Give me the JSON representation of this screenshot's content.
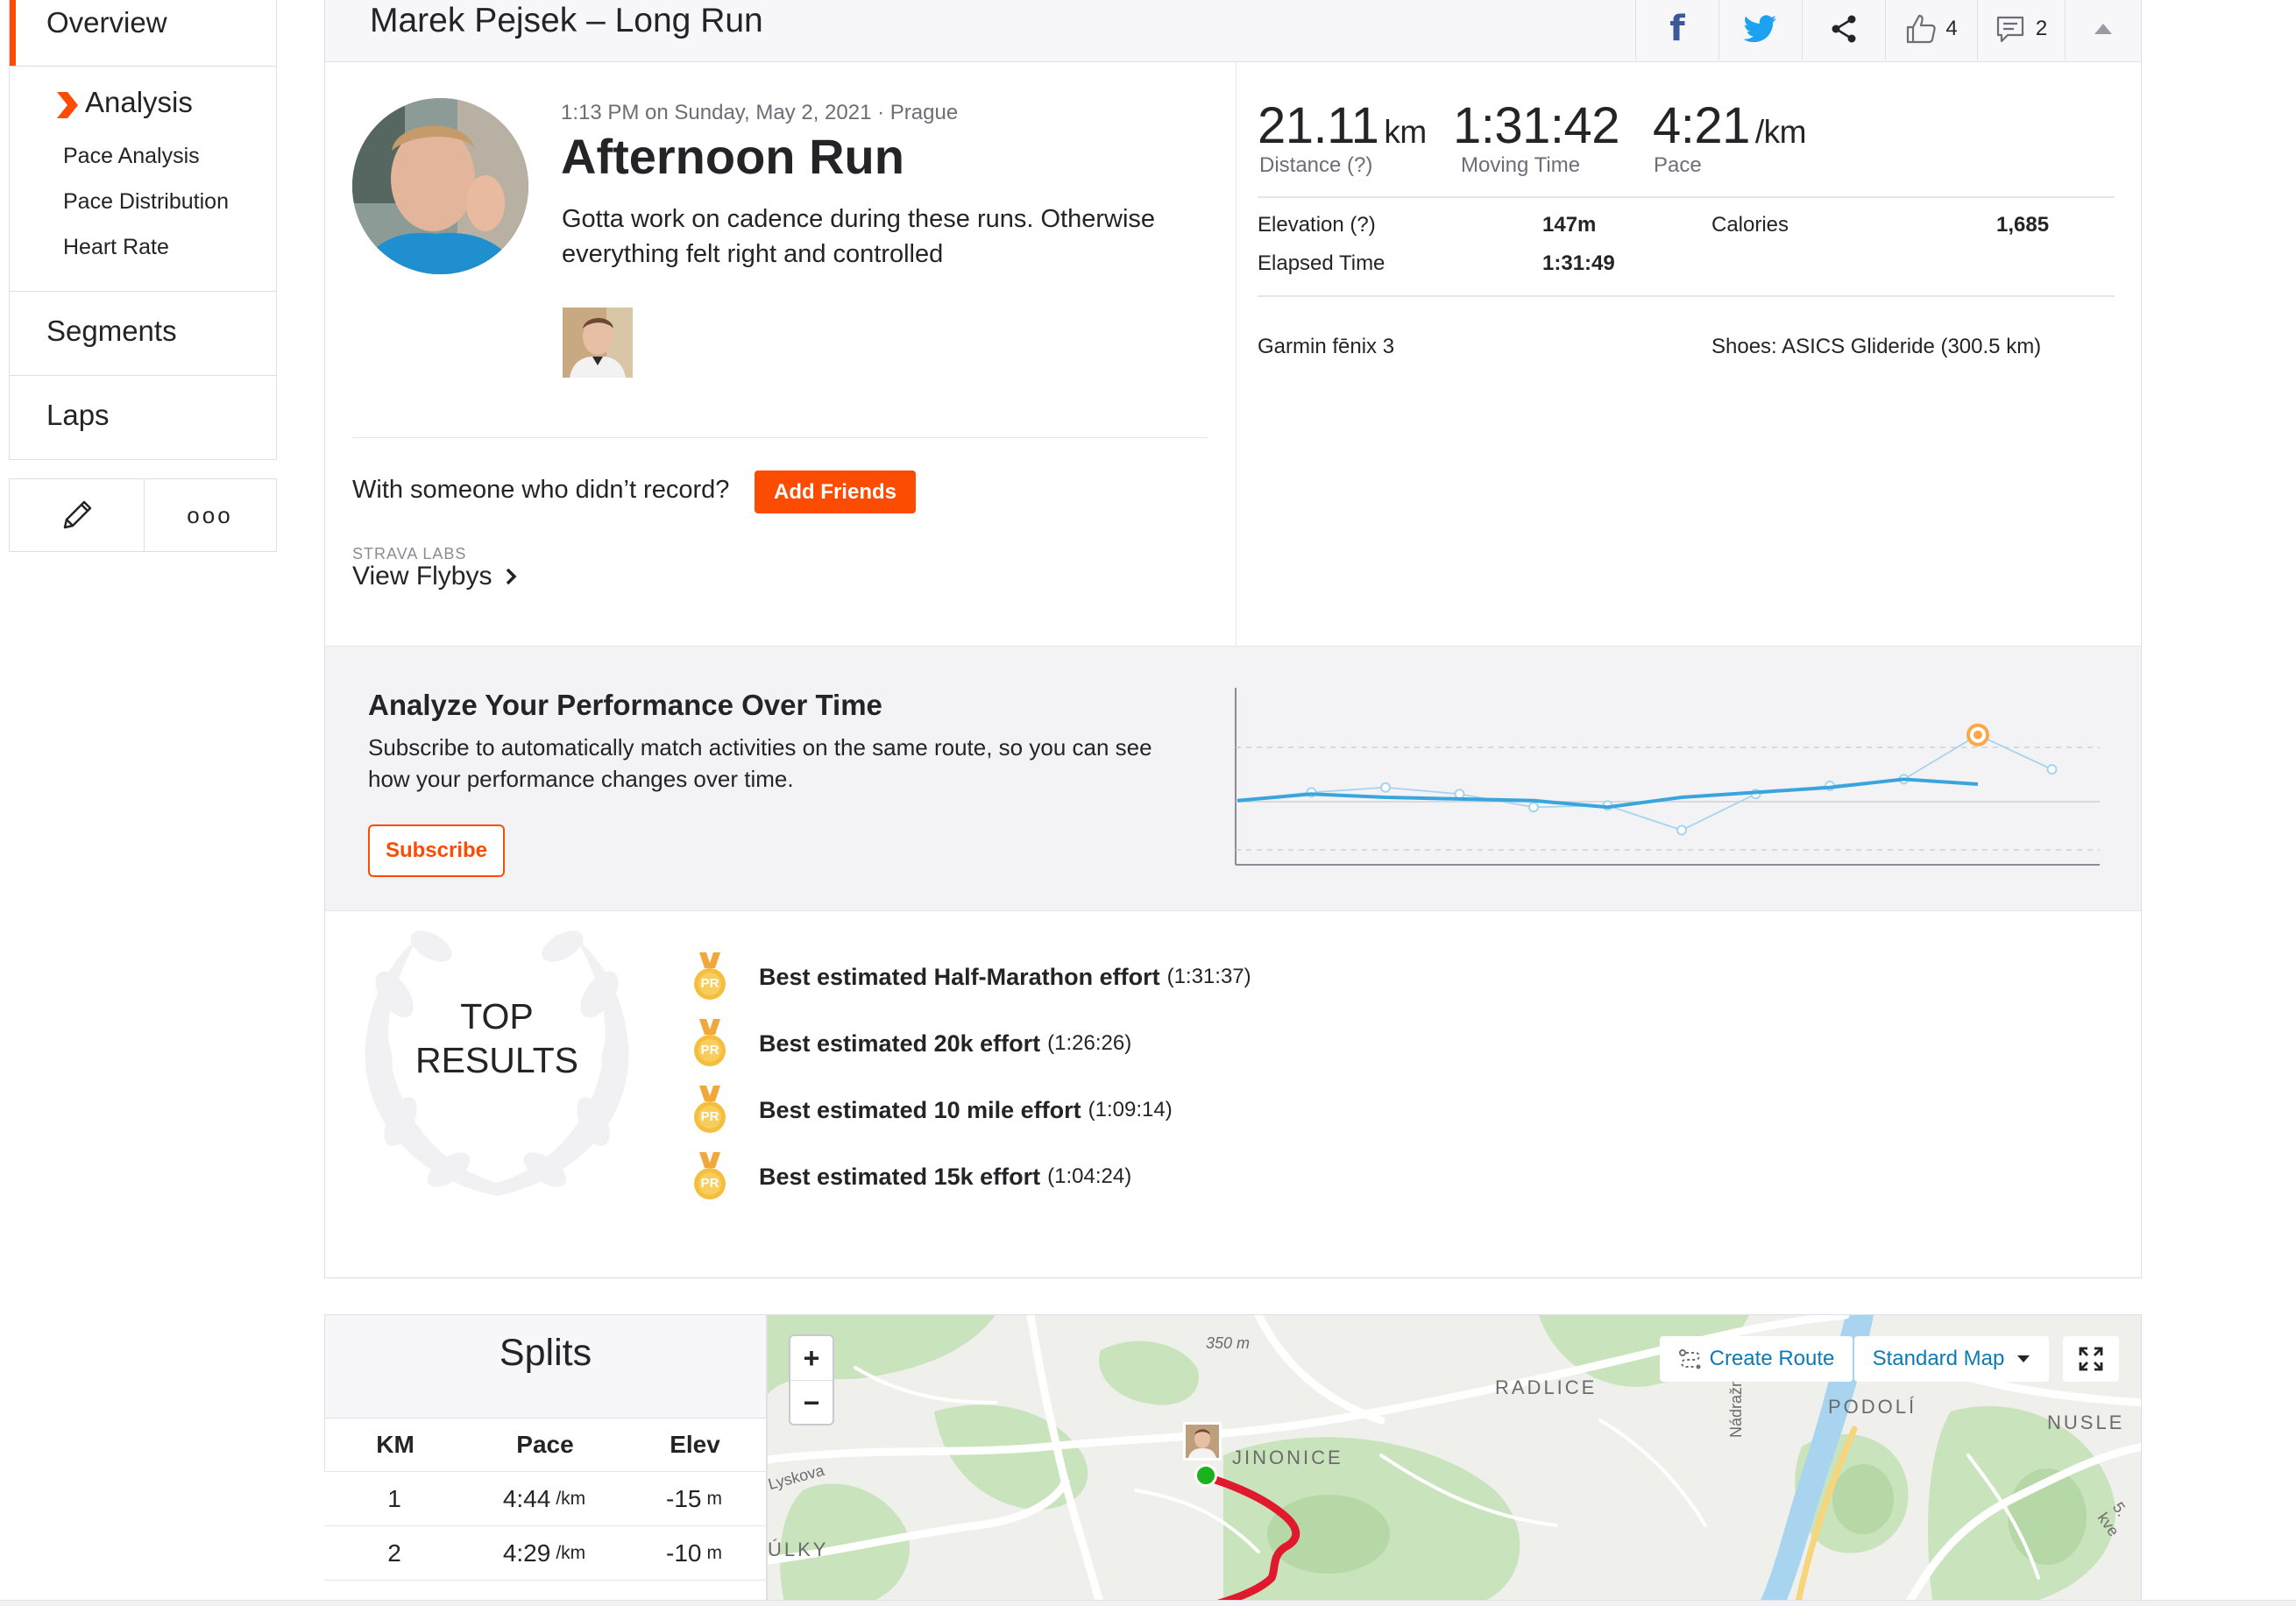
{
  "sidebar": {
    "overview_label": "Overview",
    "analysis_label": "Analysis",
    "analysis_items": [
      "Pace Analysis",
      "Pace Distribution",
      "Heart Rate"
    ],
    "segments_label": "Segments",
    "laps_label": "Laps",
    "more_label": "ooo"
  },
  "header": {
    "title": "Marek Pejsek – Long Run",
    "kudos_count": "4",
    "comments_count": "2"
  },
  "activity": {
    "datetime_location": "1:13 PM on Sunday, May 2, 2021 · Prague",
    "name": "Afternoon Run",
    "description": "Gotta work on cadence during these runs. Otherwise everything felt right and controlled",
    "with_someone_text": "With someone who didn’t record?",
    "add_friends_label": "Add Friends",
    "labs_label": "STRAVA LABS",
    "flybys_label": "View Flybys"
  },
  "stats": {
    "distance_value": "21.11",
    "distance_unit": "km",
    "distance_label": "Distance (?)",
    "moving_time_value": "1:31:42",
    "moving_time_label": "Moving Time",
    "pace_value": "4:21",
    "pace_unit": "/km",
    "pace_label": "Pace",
    "elevation_label": "Elevation (?)",
    "elevation_value": "147m",
    "calories_label": "Calories",
    "calories_value": "1,685",
    "elapsed_label": "Elapsed Time",
    "elapsed_value": "1:31:49",
    "device": "Garmin fēnix 3",
    "shoes": "Shoes: ASICS Glideride (300.5 km)"
  },
  "analyze": {
    "title": "Analyze Your Performance Over Time",
    "text": "Subscribe to automatically match activities on the same route, so you can see how your performance changes over time.",
    "subscribe_label": "Subscribe"
  },
  "chart_data": {
    "type": "line",
    "series": [
      {
        "values": [
          3.0,
          3.4,
          3.2,
          3.1,
          3.0,
          2.6,
          3.2,
          3.5,
          3.8,
          4.3,
          4.0
        ]
      },
      {
        "values": [
          3.0,
          3.5,
          3.8,
          3.4,
          2.6,
          2.7,
          1.2,
          3.4,
          3.9,
          4.3,
          7.0,
          4.9
        ]
      }
    ],
    "highlight_index": 10,
    "grid": true,
    "colors": {
      "main": "#3aa5dc",
      "ghost": "#a6d4ee",
      "highlight": "#fca74a"
    }
  },
  "top_results": {
    "title_line1": "TOP",
    "title_line2": "RESULTS",
    "badge": "PR",
    "items": [
      {
        "label": "Best estimated Half-Marathon effort",
        "time": "(1:31:37)"
      },
      {
        "label": "Best estimated 20k effort",
        "time": "(1:26:26)"
      },
      {
        "label": "Best estimated 10 mile effort",
        "time": "(1:09:14)"
      },
      {
        "label": "Best estimated 15k effort",
        "time": "(1:04:24)"
      }
    ]
  },
  "splits": {
    "title": "Splits",
    "columns": [
      "KM",
      "Pace",
      "Elev"
    ],
    "rows": [
      {
        "km": "1",
        "pace": "4:44",
        "pace_unit": "/km",
        "elev": "-15",
        "elev_unit": "m"
      },
      {
        "km": "2",
        "pace": "4:29",
        "pace_unit": "/km",
        "elev": "-10",
        "elev_unit": "m"
      }
    ]
  },
  "map": {
    "zoom_in": "+",
    "zoom_out": "−",
    "create_route_label": "Create Route",
    "map_type_label": "Standard Map",
    "labels": {
      "elev_350": "350 m",
      "radlice": "RADLICE",
      "podoli": "PODOLÍ",
      "nusle": "NUSLE",
      "jinonice": "JINONICE",
      "lyskova": "Lyskova",
      "ulky": "ÚLKY",
      "nadrazni": "Nádražní",
      "kve": "5. kve"
    }
  },
  "colors": {
    "strava_orange": "#fc4c02",
    "link_blue": "#0c7bb5",
    "route_red": "#e0192d",
    "start_green": "#1ab21a"
  }
}
